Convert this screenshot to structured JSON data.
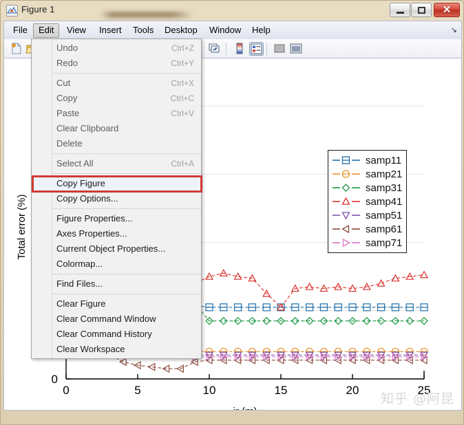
{
  "window": {
    "title": "Figure 1",
    "app_icon": "matlab-figure-icon",
    "controls": {
      "minimize": "minimize-button",
      "maximize": "restore-button",
      "close_glyph": "✕"
    }
  },
  "menubar": {
    "items": [
      {
        "label": "File",
        "active": false
      },
      {
        "label": "Edit",
        "active": true
      },
      {
        "label": "View",
        "active": false
      },
      {
        "label": "Insert",
        "active": false
      },
      {
        "label": "Tools",
        "active": false
      },
      {
        "label": "Desktop",
        "active": false
      },
      {
        "label": "Window",
        "active": false
      },
      {
        "label": "Help",
        "active": false
      }
    ],
    "overflow_glyph": "↘"
  },
  "toolbar": {
    "buttons": [
      {
        "name": "new-figure-icon"
      },
      {
        "name": "open-file-icon"
      },
      {
        "name": "link-plot-icon"
      },
      {
        "name": "colorbar-icon"
      },
      {
        "name": "legend-icon",
        "pressed": true
      },
      {
        "name": "hide-plot-tools-icon"
      },
      {
        "name": "show-plot-tools-icon"
      }
    ]
  },
  "edit_menu": {
    "items": [
      {
        "label": "Undo",
        "accel": "Ctrl+Z",
        "enabled": false
      },
      {
        "label": "Redo",
        "accel": "Ctrl+Y",
        "enabled": false
      },
      {
        "sep": true
      },
      {
        "label": "Cut",
        "accel": "Ctrl+X",
        "enabled": false
      },
      {
        "label": "Copy",
        "accel": "Ctrl+C",
        "enabled": false
      },
      {
        "label": "Paste",
        "accel": "Ctrl+V",
        "enabled": false
      },
      {
        "label": "Clear Clipboard",
        "accel": "",
        "enabled": false
      },
      {
        "label": "Delete",
        "accel": "",
        "enabled": false
      },
      {
        "sep": true
      },
      {
        "label": "Select All",
        "accel": "Ctrl+A",
        "enabled": false
      },
      {
        "sep": true
      },
      {
        "label": "Copy Figure",
        "accel": "",
        "enabled": true,
        "highlight": true
      },
      {
        "label": "Copy Options...",
        "accel": "",
        "enabled": true
      },
      {
        "sep": true
      },
      {
        "label": "Figure Properties...",
        "accel": "",
        "enabled": true
      },
      {
        "label": "Axes Properties...",
        "accel": "",
        "enabled": true
      },
      {
        "label": "Current Object Properties...",
        "accel": "",
        "enabled": true
      },
      {
        "label": "Colormap...",
        "accel": "",
        "enabled": true
      },
      {
        "sep": true
      },
      {
        "label": "Find Files...",
        "accel": "",
        "enabled": true
      },
      {
        "sep": true
      },
      {
        "label": "Clear Figure",
        "accel": "",
        "enabled": true
      },
      {
        "label": "Clear Command Window",
        "accel": "",
        "enabled": true
      },
      {
        "label": "Clear Command History",
        "accel": "",
        "enabled": true
      },
      {
        "label": "Clear Workspace",
        "accel": "",
        "enabled": true
      }
    ],
    "annotation_color": "#d03a33",
    "annotated_item": "Copy Figure"
  },
  "figure": {
    "watermark": "知乎 @阿昆"
  },
  "chart_data": {
    "type": "line",
    "title": "",
    "xlabel": "ir (m)",
    "ylabel": "Total error (%)",
    "xlim": [
      0,
      25
    ],
    "ylim": [
      0,
      100
    ],
    "xticks": [
      0,
      5,
      10,
      15,
      20,
      25
    ],
    "xticklabels": [
      "0",
      "5",
      "10",
      "15",
      "20",
      "25"
    ],
    "yticks": [
      0
    ],
    "yticklabels": [
      "0"
    ],
    "grid": true,
    "legend_position": "upper right",
    "x": [
      1,
      2,
      3,
      4,
      5,
      6,
      7,
      8,
      9,
      10,
      11,
      12,
      13,
      14,
      15,
      16,
      17,
      18,
      19,
      20,
      21,
      22,
      23,
      24,
      25
    ],
    "series": [
      {
        "name": "samp11",
        "color": "#1f6fa8",
        "marker": "square",
        "values": [
          64,
          46,
          34,
          28,
          25,
          23,
          22,
          22,
          21.5,
          21,
          21,
          21,
          21,
          21,
          21,
          21,
          21,
          21,
          21,
          21,
          21,
          21,
          21,
          21,
          21
        ]
      },
      {
        "name": "samp21",
        "color": "#e8932a",
        "marker": "circle",
        "values": [
          40,
          24,
          16,
          12,
          10,
          9,
          8.5,
          8,
          8,
          8,
          8,
          8,
          8,
          8,
          8,
          8,
          8,
          8,
          8,
          8,
          8,
          8,
          8,
          8,
          8
        ]
      },
      {
        "name": "samp31",
        "color": "#1a9641",
        "marker": "diamond",
        "values": [
          62,
          42,
          30,
          24,
          21,
          19,
          18,
          17.5,
          22,
          17,
          17,
          17,
          17,
          17,
          17,
          17,
          17,
          17,
          17,
          17,
          17,
          17,
          17,
          17,
          17
        ]
      },
      {
        "name": "samp41",
        "color": "#d9302c",
        "marker": "triangle-up",
        "values": [
          78,
          58,
          44,
          36,
          32,
          30,
          29,
          28.5,
          28,
          30,
          31,
          30,
          29.5,
          25,
          21,
          26.5,
          27,
          26.5,
          27,
          26.5,
          27,
          28,
          29.5,
          30,
          30.5
        ]
      },
      {
        "name": "samp51",
        "color": "#7b52ab",
        "marker": "triangle-down",
        "values": [
          34,
          20,
          14,
          11,
          9,
          8,
          7.5,
          7,
          7,
          7,
          7,
          7,
          7,
          7,
          7,
          7,
          7,
          7,
          7,
          7,
          7,
          7,
          7,
          7,
          7
        ]
      },
      {
        "name": "samp61",
        "color": "#8c4a3a",
        "marker": "triangle-left",
        "values": [
          20,
          11,
          7,
          5,
          4,
          3.5,
          3,
          3,
          5,
          5.5,
          5.5,
          5.5,
          5.5,
          5.5,
          5.5,
          5.5,
          5.5,
          5.5,
          5.5,
          5.5,
          5.5,
          5.5,
          5.5,
          5.5,
          5.5
        ]
      },
      {
        "name": "samp71",
        "color": "#d878c8",
        "marker": "triangle-right",
        "values": [
          36,
          22,
          15,
          11.5,
          9.5,
          8.5,
          8,
          7.5,
          6.5,
          6.5,
          6.5,
          6.5,
          6.5,
          6.5,
          6.5,
          6.5,
          6.5,
          6.5,
          6.5,
          6.5,
          6.5,
          6.5,
          6.5,
          6.5,
          6.5
        ]
      }
    ]
  }
}
